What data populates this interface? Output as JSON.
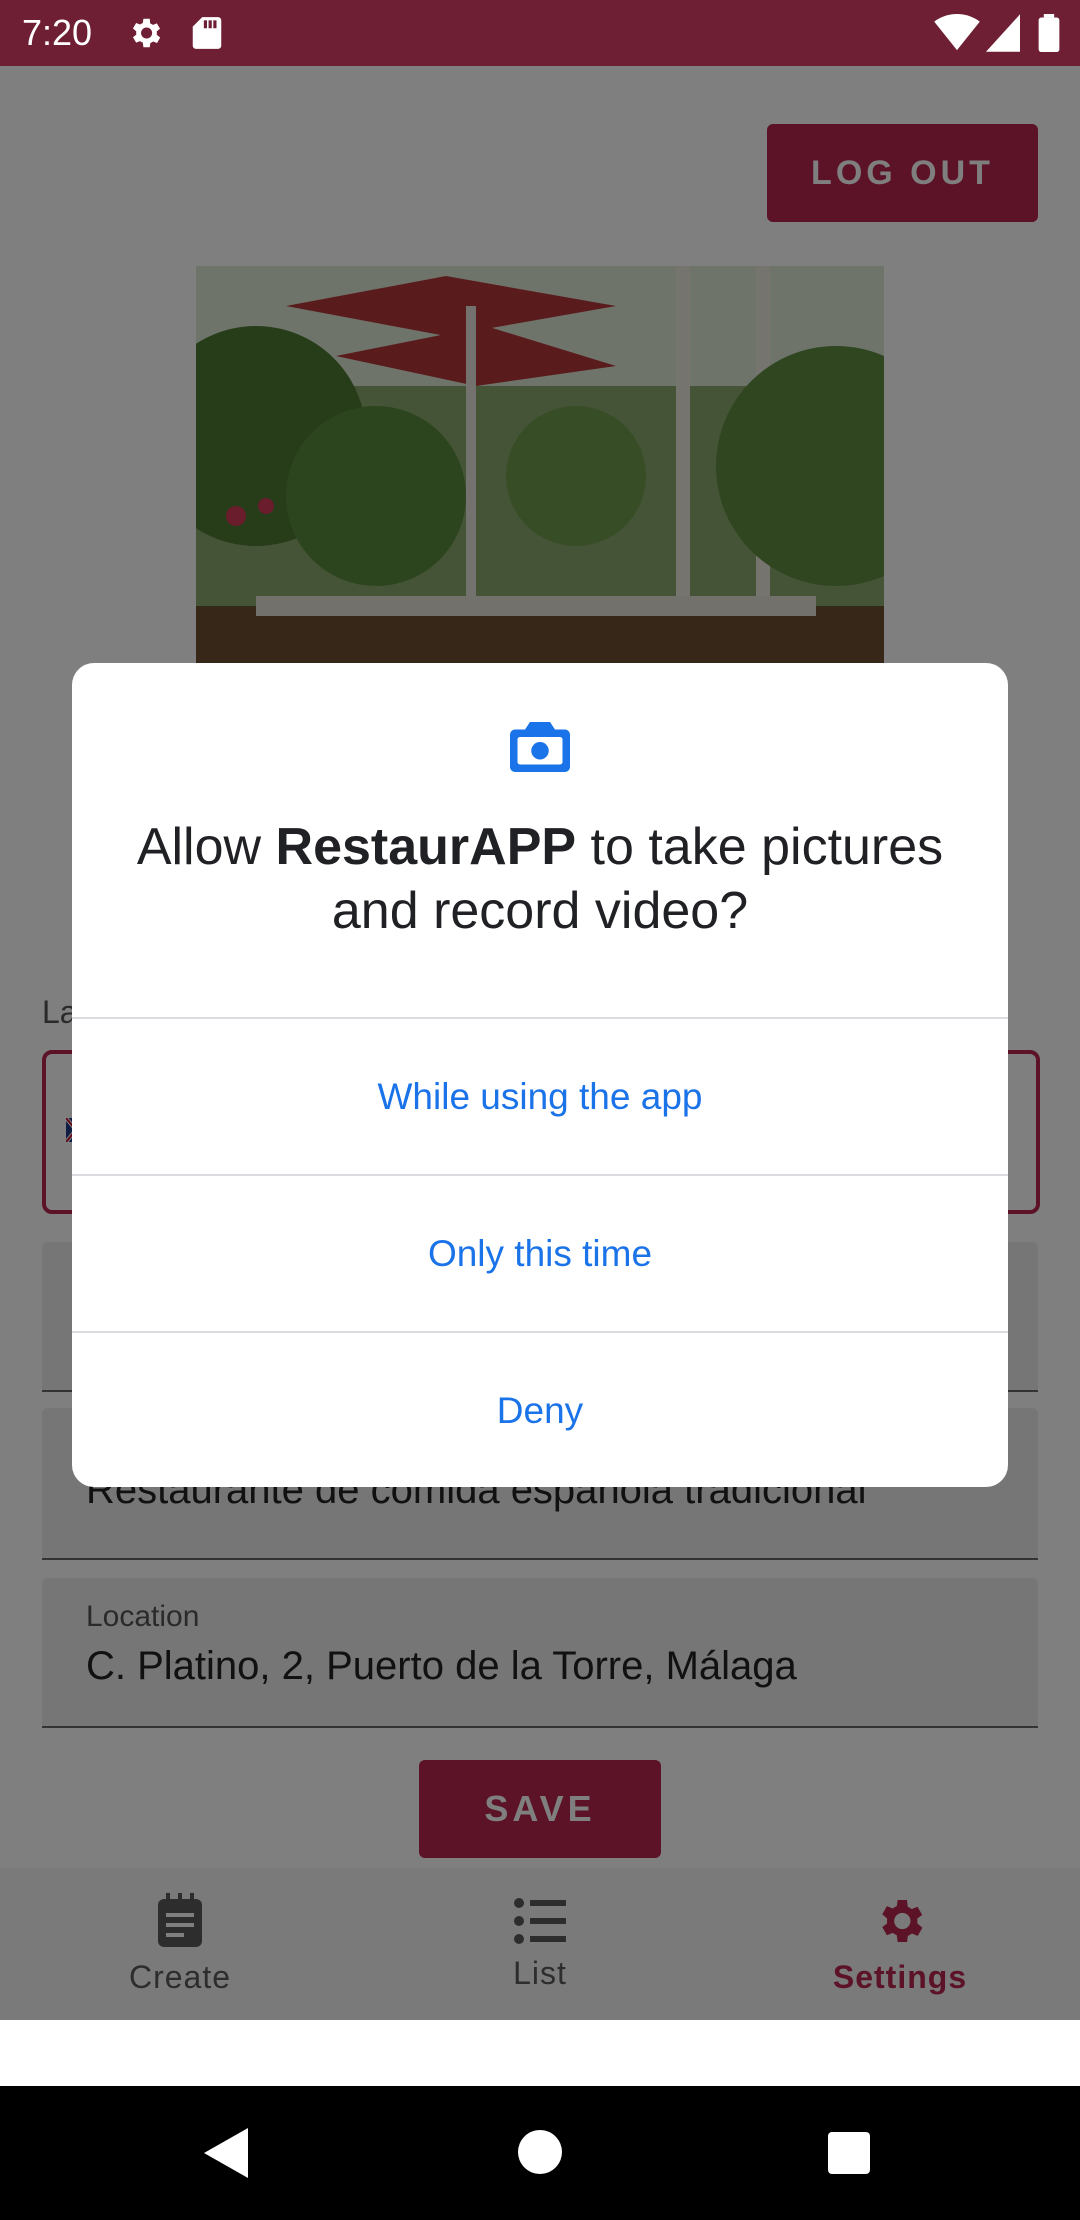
{
  "status_bar": {
    "time": "7:20",
    "icons": [
      "settings-icon",
      "sd-card-icon",
      "wifi-icon",
      "signal-icon",
      "battery-icon"
    ]
  },
  "app": {
    "logout_label": "LOG OUT",
    "language_label": "La",
    "description_value": "Restaurante de comida española tradicional",
    "location": {
      "label": "Location",
      "value": "C. Platino, 2, Puerto de la Torre, Málaga"
    },
    "save_label": "SAVE",
    "bottom_nav": [
      {
        "label": "Create",
        "icon": "notepad-icon"
      },
      {
        "label": "List",
        "icon": "list-icon"
      },
      {
        "label": "Settings",
        "icon": "gear-icon"
      }
    ],
    "colors": {
      "accent": "#b8244e",
      "status_bar": "#6e1f33",
      "dialog_button": "#1a73e8"
    }
  },
  "dialog": {
    "icon": "camera-icon",
    "title_prefix": "Allow ",
    "app_name": "RestaurAPP",
    "title_suffix": " to take pictures and record video?",
    "options": [
      "While using the app",
      "Only this time",
      "Deny"
    ]
  }
}
